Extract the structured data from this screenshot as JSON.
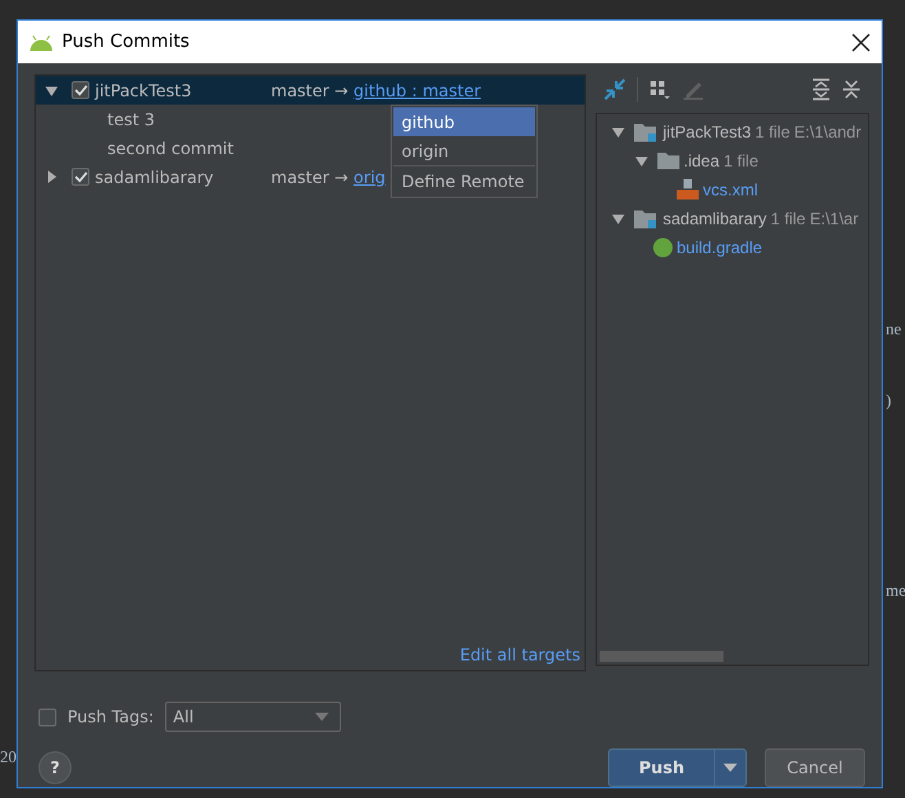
{
  "window": {
    "title": "Push Commits"
  },
  "editor_fragments": [
    {
      "text": "ne"
    },
    {
      "text": ")"
    },
    {
      "text": "me"
    },
    {
      "text": "20"
    }
  ],
  "commit_tree": [
    {
      "name": "jitPackTest3",
      "checked": true,
      "expanded": true,
      "selected": true,
      "source": "master",
      "arrow": "→",
      "target": "github : master",
      "children": [
        {
          "name": "test 3"
        },
        {
          "name": "second commit"
        }
      ]
    },
    {
      "name": "sadamlibarary",
      "checked": true,
      "expanded": false,
      "selected": false,
      "source": "master",
      "arrow": "→",
      "target": "orig"
    }
  ],
  "remote_menu": [
    {
      "label": "github",
      "selected": true
    },
    {
      "label": "origin",
      "selected": false
    },
    {
      "label": "Define Remote",
      "selected": false
    }
  ],
  "edit_all_targets": "Edit all targets",
  "file_tree": [
    {
      "kind": "repo",
      "name": "jitPackTest3",
      "count": "1 file",
      "path": "E:\\1\\andr",
      "expanded": true,
      "children": [
        {
          "kind": "folder",
          "name": ".idea",
          "count": "1 file",
          "expanded": true,
          "children": [
            {
              "kind": "xml",
              "name": "vcs.xml"
            }
          ]
        }
      ]
    },
    {
      "kind": "repo",
      "name": "sadamlibarary",
      "count": "1 file",
      "path": "E:\\1\\ar",
      "expanded": true,
      "children": [
        {
          "kind": "gradle",
          "name": "build.gradle"
        }
      ]
    }
  ],
  "push_tags": {
    "label": "Push Tags:",
    "checked": false,
    "value": "All"
  },
  "buttons": {
    "help": "?",
    "push": "Push",
    "cancel": "Cancel"
  }
}
